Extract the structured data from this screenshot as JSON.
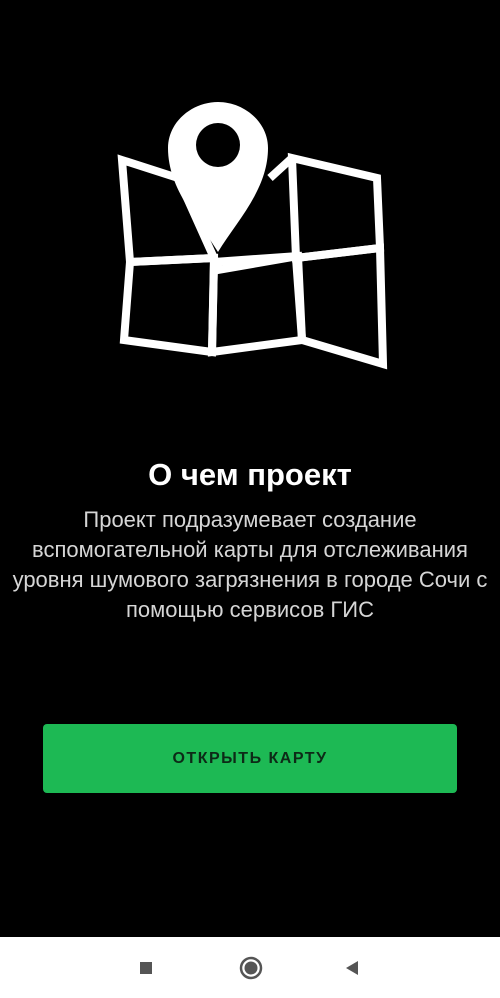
{
  "about": {
    "title": "О чем проект",
    "description": "Проект подразумевает создание вспомогательной карты для отслеживания уровня шумового загрязнения в городе Сочи с помощью сервисов ГИС",
    "illustration_icon": "map-pin-icon",
    "open_map_button_label": "ОТКРЫТЬ КАРТУ"
  },
  "navigation_bar": {
    "recents_icon": "square-icon",
    "home_icon": "circle-icon",
    "back_icon": "triangle-back-icon"
  },
  "colors": {
    "background": "#000000",
    "accent": "#1db954",
    "title_text": "#ffffff",
    "body_text": "#d6d6d6",
    "nav_background": "#ffffff",
    "nav_icons": "#555555"
  }
}
